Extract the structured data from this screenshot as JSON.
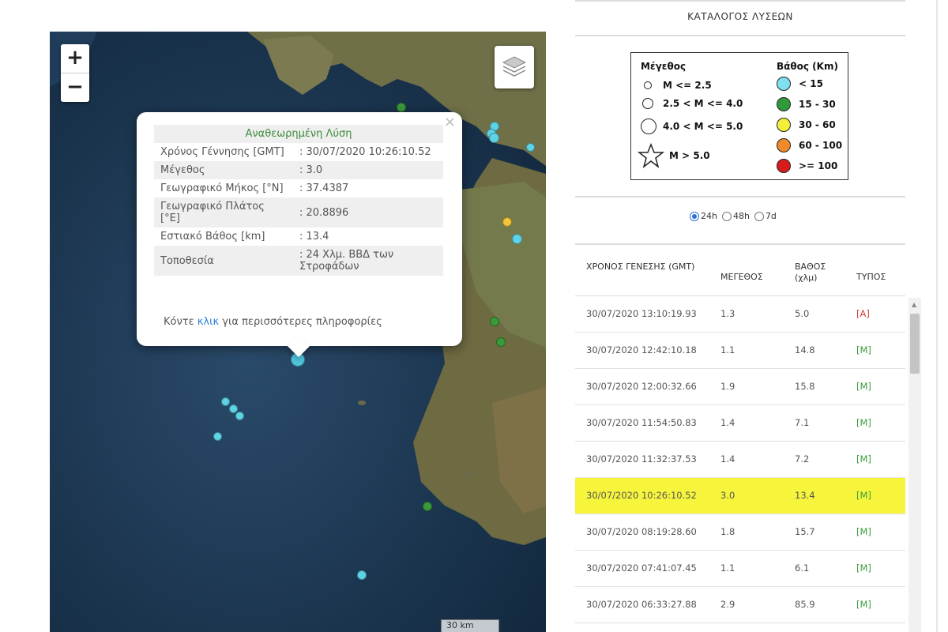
{
  "map": {
    "zoom_in": "+",
    "zoom_out": "−",
    "layers_icon": "layers-icon",
    "scale": "30 km",
    "popup": {
      "title": "Αναθεωρημένη Λύση",
      "close": "×",
      "rows": [
        {
          "label": "Χρόνος Γέννησης [GMT]",
          "value": ": 30/07/2020 10:26:10.52"
        },
        {
          "label": "Μέγεθος",
          "value": ": 3.0"
        },
        {
          "label": "Γεωγραφικό Μήκος [°N]",
          "value": ": 37.4387"
        },
        {
          "label": "Γεωγραφικό Πλάτος [°E]",
          "value": ": 20.8896"
        },
        {
          "label": "Εστιακό Βάθος [km]",
          "value": ": 13.4"
        },
        {
          "label": "Τοποθεσία",
          "value": ": 24 Χλμ. ΒΒΔ των Στροφάδων"
        }
      ],
      "more_prefix": "Κόντε",
      "more_link": "κλικ",
      "more_suffix": "για περισσότερες πληροφορίες"
    },
    "colors": {
      "cyan": "#5ed3e6",
      "green": "#3a9a3a",
      "yellow": "#f2c53a",
      "selected": "#4fc4dc"
    }
  },
  "panel": {
    "title": "ΚΑΤΑΛΟΓΟΣ ΛΥΣΕΩΝ",
    "legend": {
      "size_header": "Μέγεθος",
      "depth_header": "Βάθος (Km)",
      "sizes": [
        "M <= 2.5",
        "2.5 < M <= 4.0",
        "4.0 < M <= 5.0",
        "M > 5.0"
      ],
      "depths": [
        {
          "label": "< 15",
          "color": "#7fe0f0"
        },
        {
          "label": "15 - 30",
          "color": "#2f9a3a"
        },
        {
          "label": "30 - 60",
          "color": "#f3ee3a"
        },
        {
          "label": "60 - 100",
          "color": "#f08a2a"
        },
        {
          "label": ">= 100",
          "color": "#d81c1c"
        }
      ]
    },
    "periods": [
      {
        "label": "24h",
        "selected": true
      },
      {
        "label": "48h",
        "selected": false
      },
      {
        "label": "7d",
        "selected": false
      }
    ],
    "columns": {
      "time": "ΧΡΟΝΟΣ ΓΕΝΕΣΗΣ (GMT)",
      "magnitude": "ΜΕΓΕΘΟΣ",
      "depth": "ΒΑΘΟΣ (χλμ)",
      "type": "ΤΥΠΟΣ"
    },
    "rows": [
      {
        "time": "30/07/2020 13:10:19.93",
        "mag": "1.3",
        "depth": "5.0",
        "type": "[A]"
      },
      {
        "time": "30/07/2020 12:42:10.18",
        "mag": "1.1",
        "depth": "14.8",
        "type": "[M]"
      },
      {
        "time": "30/07/2020 12:00:32.66",
        "mag": "1.9",
        "depth": "15.8",
        "type": "[M]"
      },
      {
        "time": "30/07/2020 11:54:50.83",
        "mag": "1.4",
        "depth": "7.1",
        "type": "[M]"
      },
      {
        "time": "30/07/2020 11:32:37.53",
        "mag": "1.4",
        "depth": "7.2",
        "type": "[M]"
      },
      {
        "time": "30/07/2020 10:26:10.52",
        "mag": "3.0",
        "depth": "13.4",
        "type": "[M]",
        "highlight": true
      },
      {
        "time": "30/07/2020 08:19:28.60",
        "mag": "1.8",
        "depth": "15.7",
        "type": "[M]"
      },
      {
        "time": "30/07/2020 07:41:07.45",
        "mag": "1.1",
        "depth": "6.1",
        "type": "[M]"
      },
      {
        "time": "30/07/2020 06:33:27.88",
        "mag": "2.9",
        "depth": "85.9",
        "type": "[M]"
      }
    ]
  }
}
